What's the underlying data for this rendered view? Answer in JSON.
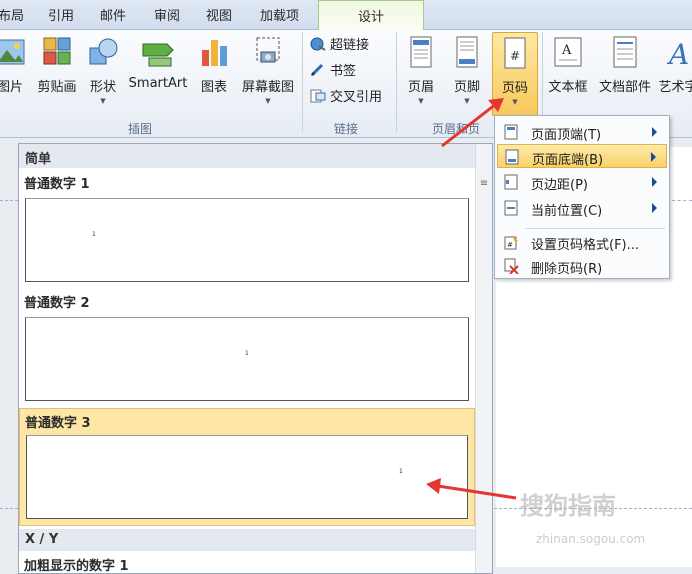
{
  "tabs": [
    "布局",
    "引用",
    "邮件",
    "审阅",
    "视图",
    "加载项",
    "设计"
  ],
  "ribbon": {
    "illustrations": {
      "picture": "图片",
      "clipart": "剪贴画",
      "shapes": "形状",
      "smartart": "SmartArt",
      "chart": "图表",
      "screenshot": "屏幕截图",
      "group_label": "插图"
    },
    "links": {
      "hyperlink": "超链接",
      "bookmark": "书签",
      "crossref": "交叉引用",
      "group_label": "链接"
    },
    "header_footer": {
      "header": "页眉",
      "footer": "页脚",
      "page_number": "页码",
      "group_label": "页眉和页"
    },
    "text": {
      "textbox": "文本框",
      "quickparts": "文档部件",
      "wordart": "艺术字"
    }
  },
  "menu": {
    "items": [
      {
        "label": "页面顶端(T)",
        "has_submenu": true
      },
      {
        "label": "页面底端(B)",
        "has_submenu": true,
        "highlighted": true
      },
      {
        "label": "页边距(P)",
        "has_submenu": true
      },
      {
        "label": "当前位置(C)",
        "has_submenu": true
      },
      {
        "label": "设置页码格式(F)...",
        "has_submenu": false
      },
      {
        "label": "删除页码(R)",
        "has_submenu": false
      }
    ]
  },
  "gallery": {
    "section_simple": "简单",
    "items": [
      {
        "label": "普通数字 1",
        "align": "left",
        "sample": "1"
      },
      {
        "label": "普通数字 2",
        "align": "center",
        "sample": "1"
      },
      {
        "label": "普通数字 3",
        "align": "right",
        "sample": "1",
        "selected": true
      }
    ],
    "section_xy": "X / Y",
    "next_item_label": "加粗显示的数字 1"
  },
  "watermark": {
    "line1": "搜狗指南",
    "line2": "zhinan.sogou.com"
  },
  "colors": {
    "highlight": "#f9d26b",
    "arrow": "#e53530",
    "accent_blue": "#1c4c9a"
  }
}
